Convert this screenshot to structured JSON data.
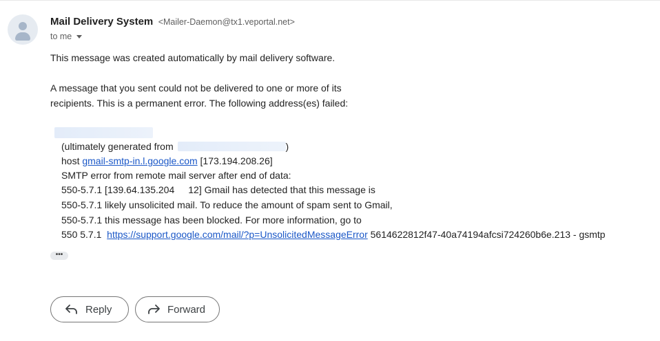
{
  "header": {
    "sender_name": "Mail Delivery System",
    "sender_email": "<Mailer-Daemon@tx1.veportal.net>",
    "recipient_label": "to me"
  },
  "body": {
    "line1": "This message was created automatically by mail delivery software.",
    "line2": "A message that you sent could not be delivered to one or more of its",
    "line3": "recipients. This is a permanent error. The following address(es) failed:",
    "generated_prefix": "(ultimately generated from",
    "generated_suffix": ")",
    "host_prefix": "host",
    "host_link": "gmail-smtp-in.l.google.com",
    "host_ip": "[173.194.208.26]",
    "smtp_line": "SMTP error from remote mail server after end of data:",
    "err1_a": "550-5.7.1 [139.64.135.204",
    "err1_b": "12] Gmail has detected that this message is",
    "err2": "550-5.7.1 likely unsolicited mail. To reduce the amount of spam sent to Gmail,",
    "err3": "550-5.7.1 this message has been blocked. For more information, go to",
    "err4_prefix": "550 5.7.1",
    "err4_link": "https://support.google.com/mail/?p=UnsolicitedMessageError",
    "err4_suffix": "5614622812f47-40a74194afcsi724260b6e.213 - gsmtp"
  },
  "show_trimmed_label": "•••",
  "actions": {
    "reply_label": "Reply",
    "forward_label": "Forward"
  },
  "colors": {
    "link": "#1a57c7",
    "redaction": "#e3ecf9",
    "avatar_bg": "#e6ebf1"
  },
  "icons": [
    "avatar-person-icon",
    "chevron-down-icon",
    "reply-arrow-icon",
    "forward-arrow-icon"
  ]
}
